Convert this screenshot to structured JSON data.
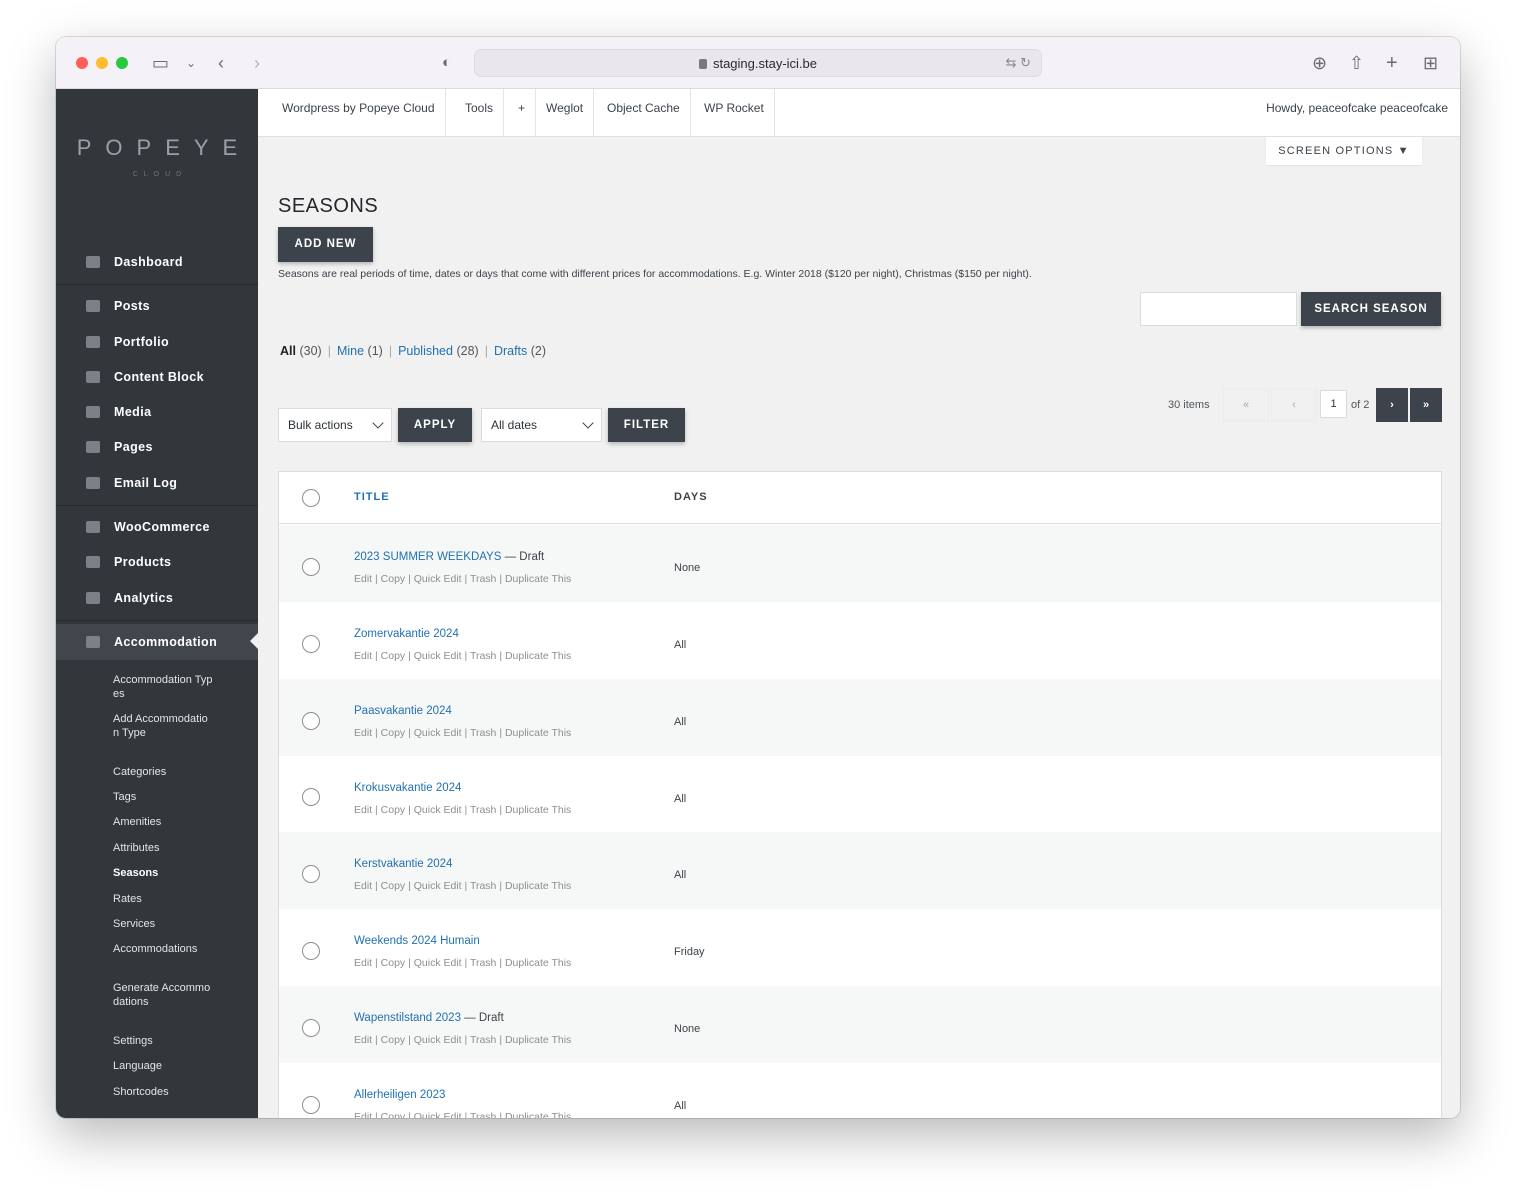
{
  "browser": {
    "url": "staging.stay-ici.be"
  },
  "logo": {
    "name": "POPEYE",
    "sub": "CLOUD"
  },
  "adminbar": {
    "items": [
      "Wordpress by Popeye Cloud",
      "Tools",
      "+",
      "Weglot",
      "Object Cache",
      "WP Rocket"
    ],
    "howdy": "Howdy, peaceofcake peaceofcake"
  },
  "sidebar": {
    "items": [
      {
        "label": "Dashboard",
        "icon": "dashboard-icon"
      },
      {
        "label": "Posts",
        "icon": "pin-icon"
      },
      {
        "label": "Portfolio",
        "icon": "grid-icon"
      },
      {
        "label": "Content Block",
        "icon": "layout-icon"
      },
      {
        "label": "Media",
        "icon": "media-icon"
      },
      {
        "label": "Pages",
        "icon": "pages-icon"
      },
      {
        "label": "Email Log",
        "icon": "email-icon"
      },
      {
        "label": "WooCommerce",
        "icon": "woo-icon"
      },
      {
        "label": "Products",
        "icon": "archive-icon"
      },
      {
        "label": "Analytics",
        "icon": "bar-chart-icon"
      },
      {
        "label": "Accommodation",
        "icon": "building-icon"
      }
    ],
    "subitems": [
      "Accommodation Types",
      "Add Accommodation Type",
      "Categories",
      "Tags",
      "Amenities",
      "Attributes",
      "Seasons",
      "Rates",
      "Services",
      "Accommodations",
      "Generate Accommodations",
      "Settings",
      "Language",
      "Shortcodes"
    ]
  },
  "main": {
    "screen_options": "SCREEN OPTIONS ▼",
    "title": "SEASONS",
    "add_new": "ADD NEW",
    "description": "Seasons are real periods of time, dates or days that come with different prices for accommodations. E.g. Winter 2018 ($120 per night), Christmas ($150 per night).",
    "search_button": "SEARCH SEASON",
    "search_value": "",
    "filters": {
      "all": "All",
      "all_count": "(30)",
      "mine": "Mine",
      "mine_count": "(1)",
      "published": "Published",
      "published_count": "(28)",
      "drafts": "Drafts",
      "drafts_count": "(2)"
    },
    "bulk_actions": "Bulk actions",
    "apply": "APPLY",
    "all_dates": "All dates",
    "filter": "FILTER",
    "pagination": {
      "items": "30 items",
      "first": "«",
      "prev": "‹",
      "current": "1",
      "of": "of 2",
      "next": "›",
      "last": "»"
    },
    "table": {
      "col_title": "TITLE",
      "col_days": "DAYS",
      "row_actions": "Edit | Copy | Quick Edit | Trash | Duplicate This",
      "rows": [
        {
          "title": "2023 SUMMER WEEKDAYS",
          "state": " — Draft",
          "days": "None"
        },
        {
          "title": "Zomervakantie 2024",
          "state": "",
          "days": "All"
        },
        {
          "title": "Paasvakantie 2024",
          "state": "",
          "days": "All"
        },
        {
          "title": "Krokusvakantie 2024",
          "state": "",
          "days": "All"
        },
        {
          "title": "Kerstvakantie 2024",
          "state": "",
          "days": "All"
        },
        {
          "title": "Weekends 2024 Humain",
          "state": "",
          "days": "Friday"
        },
        {
          "title": "Wapenstilstand 2023",
          "state": " — Draft",
          "days": "None"
        },
        {
          "title": "Allerheiligen 2023",
          "state": "",
          "days": "All"
        }
      ]
    }
  }
}
